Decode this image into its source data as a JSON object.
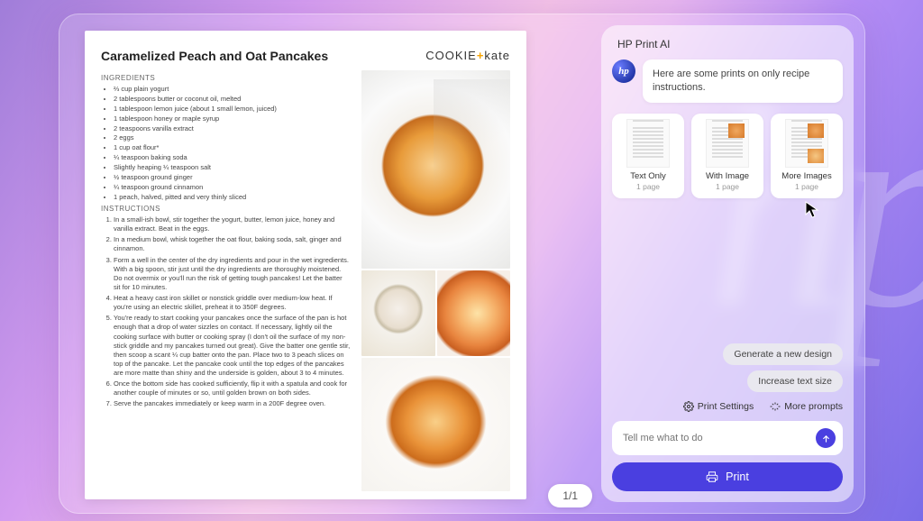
{
  "document": {
    "title": "Caramelized Peach and Oat Pancakes",
    "brand_a": "COOKIE",
    "brand_plus": "+",
    "brand_b": "kate",
    "brand_sub": "",
    "sec_ingredients": "INGREDIENTS",
    "ingredients": [
      "⅔ cup plain yogurt",
      "2 tablespoons butter or coconut oil, melted",
      "1 tablespoon lemon juice (about 1 small lemon, juiced)",
      "1 tablespoon honey or maple syrup",
      "2 teaspoons vanilla extract",
      "2 eggs",
      "1 cup oat flour*",
      "¼ teaspoon baking soda",
      "Slightly heaping ¼ teaspoon salt",
      "½ teaspoon ground ginger",
      "¼ teaspoon ground cinnamon",
      "1 peach, halved, pitted and very thinly sliced"
    ],
    "sec_instructions": "INSTRUCTIONS",
    "instructions": [
      "In a small-ish bowl, stir together the yogurt, butter, lemon juice, honey and vanilla extract. Beat in the eggs.",
      "In a medium bowl, whisk together the oat flour, baking soda, salt, ginger and cinnamon.",
      "Form a well in the center of the dry ingredients and pour in the wet ingredients. With a big spoon, stir just until the dry ingredients are thoroughly moistened. Do not overmix or you'll run the risk of getting tough pancakes! Let the batter sit for 10 minutes.",
      "Heat a heavy cast iron skillet or nonstick griddle over medium-low heat. If you're using an electric skillet, preheat it to 350F degrees.",
      "You're ready to start cooking your pancakes once the surface of the pan is hot enough that a drop of water sizzles on contact. If necessary, lightly oil the cooking surface with butter or cooking spray (I don't oil the surface of my non-stick griddle and my pancakes turned out great). Give the batter one gentle stir, then scoop a scant ¼ cup batter onto the pan. Place two to 3 peach slices on top of the pancake. Let the pancake cook until the top edges of the pancakes are more matte than shiny and the underside is golden, about 3 to 4 minutes.",
      "Once the bottom side has cooked sufficiently, flip it with a spatula and cook for another couple of minutes or so, until golden brown on both sides.",
      "Serve the pancakes immediately or keep warm in a 200F degree oven."
    ]
  },
  "page_counter": "1/1",
  "ai": {
    "panel_title": "HP Print AI",
    "avatar_text": "hp",
    "message": "Here are some prints on only recipe instructions.",
    "cards": [
      {
        "label": "Text Only",
        "sub": "1 page"
      },
      {
        "label": "With Image",
        "sub": "1 page"
      },
      {
        "label": "More Images",
        "sub": "1 page"
      }
    ],
    "chips": [
      "Generate a new design",
      "Increase text size"
    ],
    "actions": {
      "settings": "Print Settings",
      "prompts": "More prompts"
    },
    "input_placeholder": "Tell me what to do",
    "print_label": "Print"
  }
}
